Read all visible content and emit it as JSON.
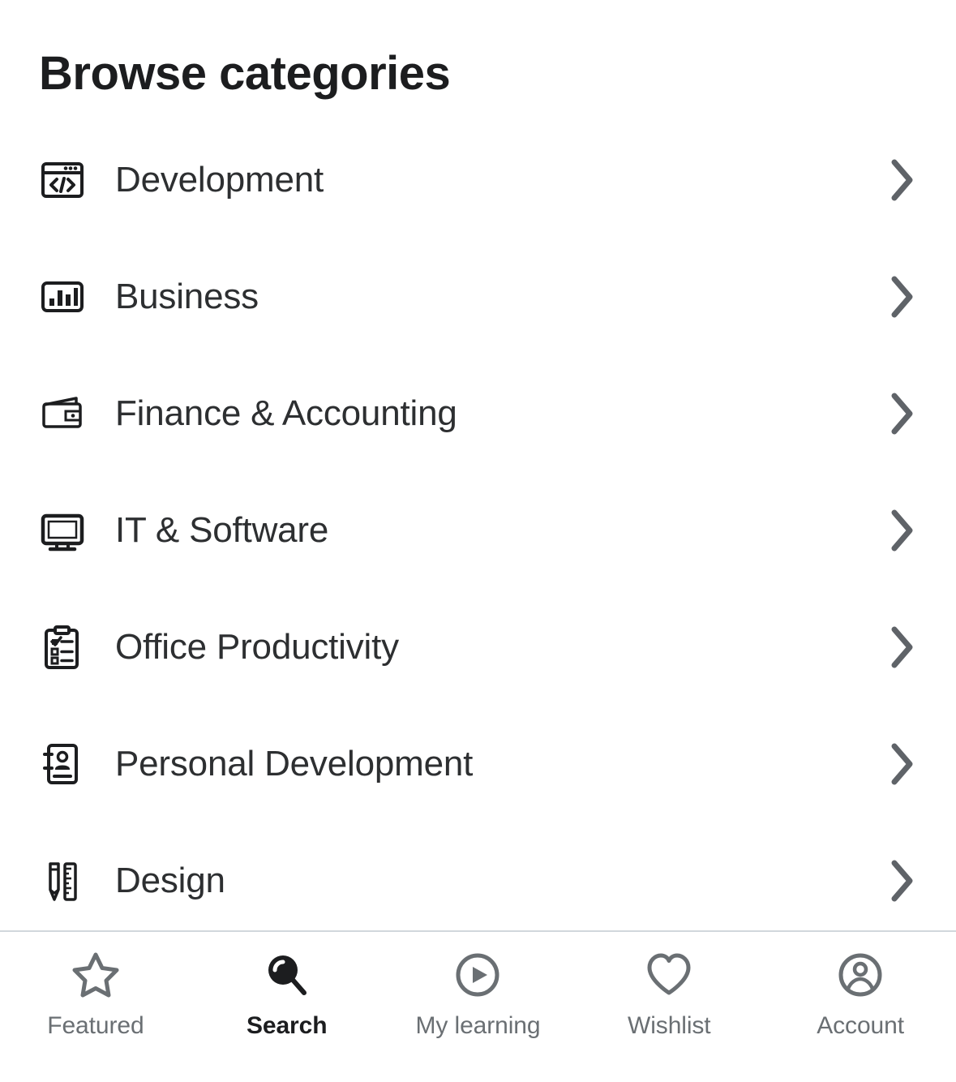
{
  "page": {
    "title": "Browse categories",
    "background": "#ffffff",
    "text_color": "#2d2f31",
    "muted_color": "#6a6f73",
    "divider_color": "#d1d7dc",
    "active_color": "#1c1d1f"
  },
  "categories": [
    {
      "label": "Development",
      "icon": "code-window-icon",
      "chevron": "chevron-right-icon"
    },
    {
      "label": "Business",
      "icon": "bar-chart-icon",
      "chevron": "chevron-right-icon"
    },
    {
      "label": "Finance & Accounting",
      "icon": "wallet-icon",
      "chevron": "chevron-right-icon"
    },
    {
      "label": "IT & Software",
      "icon": "monitor-icon",
      "chevron": "chevron-right-icon"
    },
    {
      "label": "Office Productivity",
      "icon": "clipboard-list-icon",
      "chevron": "chevron-right-icon"
    },
    {
      "label": "Personal Development",
      "icon": "address-book-icon",
      "chevron": "chevron-right-icon"
    },
    {
      "label": "Design",
      "icon": "pencil-ruler-icon",
      "chevron": "chevron-right-icon"
    }
  ],
  "bottom_nav": {
    "active_index": 1,
    "items": [
      {
        "label": "Featured",
        "icon": "star-icon",
        "active": false
      },
      {
        "label": "Search",
        "icon": "search-icon",
        "active": true
      },
      {
        "label": "My learning",
        "icon": "play-circle-icon",
        "active": false
      },
      {
        "label": "Wishlist",
        "icon": "heart-icon",
        "active": false
      },
      {
        "label": "Account",
        "icon": "user-circle-icon",
        "active": false
      }
    ]
  }
}
